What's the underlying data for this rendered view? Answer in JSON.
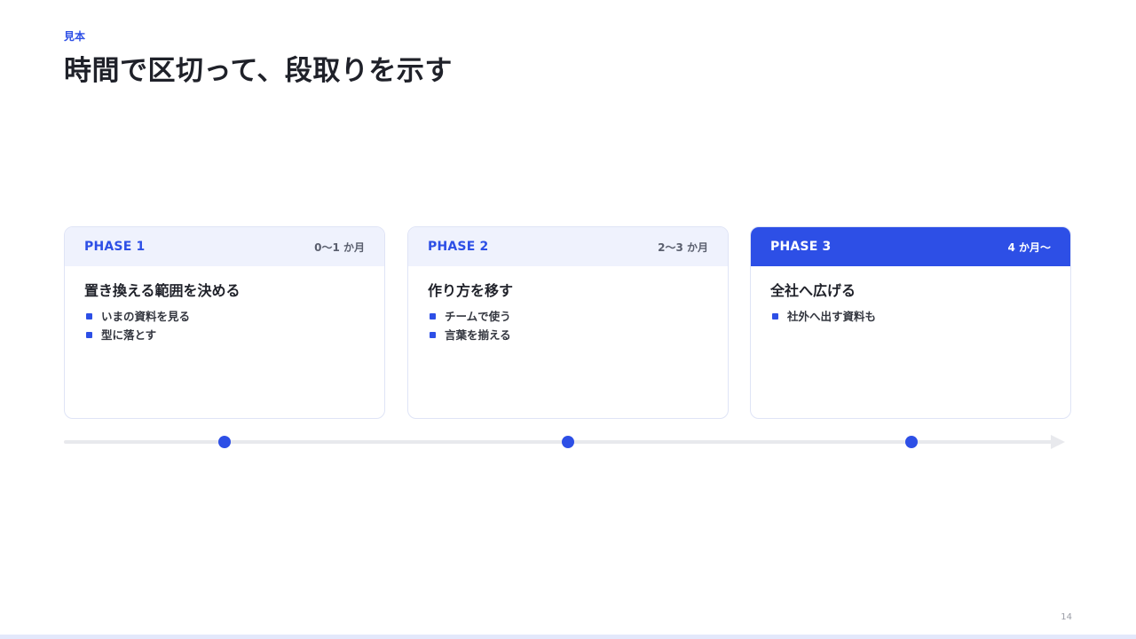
{
  "slide": {
    "eyebrow": "見本",
    "title": "時間で区切って、段取りを示す",
    "page_number": "14"
  },
  "phases": [
    {
      "label": "PHASE 1",
      "period": "0〜1 か月",
      "title": "置き換える範囲を決める",
      "bullets": [
        "いまの資料を見る",
        "型に落とす"
      ]
    },
    {
      "label": "PHASE 2",
      "period": "2〜3 か月",
      "title": "作り方を移す",
      "bullets": [
        "チームで使う",
        "言葉を揃える"
      ]
    },
    {
      "label": "PHASE 3",
      "period": "4 か月〜",
      "title": "全社へ広げる",
      "bullets": [
        "社外へ出す資料も"
      ]
    }
  ],
  "colors": {
    "accent": "#2d4fe6",
    "card_header_bg": "#eff2fd",
    "card_border": "#dfe4f6",
    "timeline": "#e8e9ed",
    "text": "#1f2129"
  },
  "icons": {
    "bullet": "square-bullet-icon",
    "timeline_marker": "circle-marker-icon",
    "timeline_end": "arrow-right-icon"
  }
}
